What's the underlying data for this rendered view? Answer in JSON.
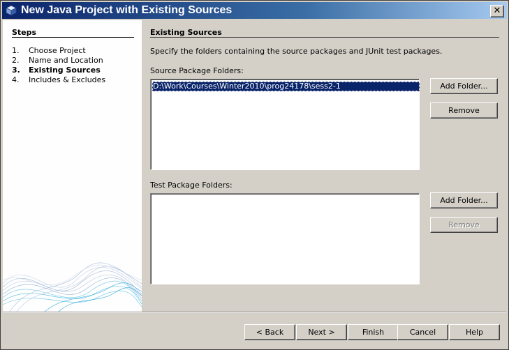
{
  "window": {
    "title": "New Java Project with Existing Sources",
    "close_label": "✕"
  },
  "steps": {
    "title": "Steps",
    "items": [
      {
        "num": "1.",
        "label": "Choose Project"
      },
      {
        "num": "2.",
        "label": "Name and Location"
      },
      {
        "num": "3.",
        "label": "Existing Sources"
      },
      {
        "num": "4.",
        "label": "Includes & Excludes"
      }
    ]
  },
  "main": {
    "title": "Existing Sources",
    "description": "Specify the folders containing the source packages and JUnit test packages.",
    "source": {
      "label": "Source Package Folders:",
      "folders": [
        "D:\\Work\\Courses\\Winter2010\\prog24178\\sess2-1"
      ],
      "add_label": "Add Folder...",
      "remove_label": "Remove"
    },
    "test": {
      "label": "Test Package Folders:",
      "folders": [],
      "add_label": "Add Folder...",
      "remove_label": "Remove"
    }
  },
  "footer": {
    "back_label": "< Back",
    "next_label": "Next >",
    "finish_label": "Finish",
    "cancel_label": "Cancel",
    "help_label": "Help"
  }
}
